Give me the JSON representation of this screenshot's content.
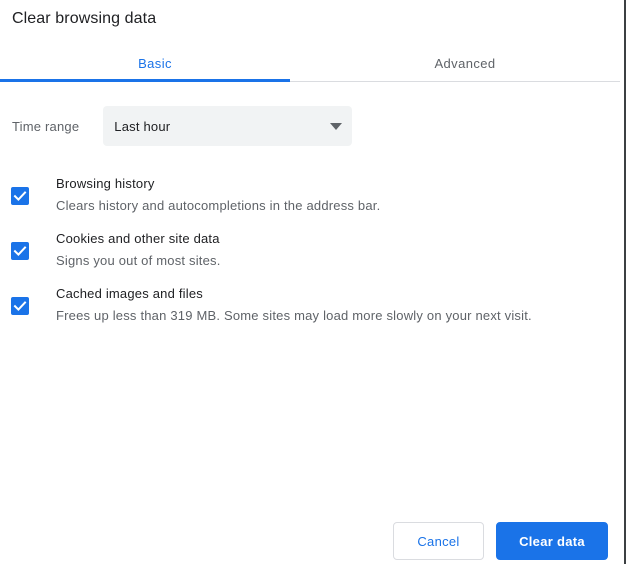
{
  "dialog": {
    "title": "Clear browsing data"
  },
  "tabs": [
    {
      "label": "Basic",
      "active": true
    },
    {
      "label": "Advanced",
      "active": false
    }
  ],
  "time_range": {
    "label": "Time range",
    "selected": "Last hour",
    "arrow_icon": "chevron-down-icon"
  },
  "options": [
    {
      "title": "Browsing history",
      "description": "Clears history and autocompletions in the address bar.",
      "checked": true
    },
    {
      "title": "Cookies and other site data",
      "description": "Signs you out of most sites.",
      "checked": true
    },
    {
      "title": "Cached images and files",
      "description": "Frees up less than 319 MB. Some sites may load more slowly on your next visit.",
      "checked": true
    }
  ],
  "footer": {
    "cancel_label": "Cancel",
    "confirm_label": "Clear data"
  },
  "colors": {
    "accent": "#1a73e8",
    "text_primary": "#202124",
    "text_secondary": "#5f6368",
    "divider": "#dadce0",
    "field_bg": "#f1f3f4"
  }
}
